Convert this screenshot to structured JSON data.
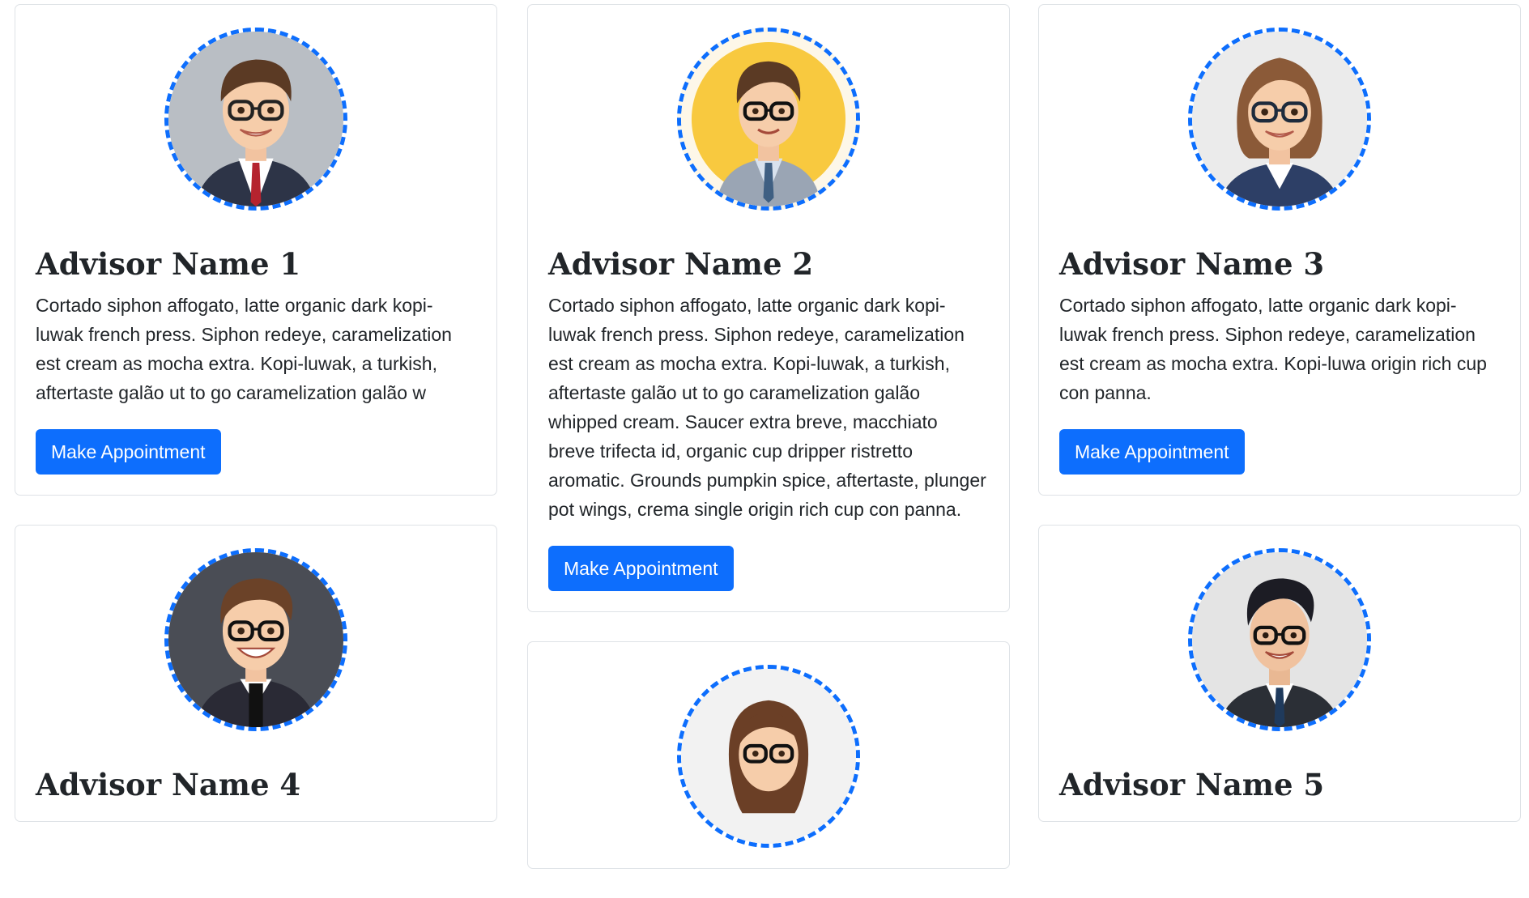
{
  "button_label": "Make Appointment",
  "advisors": [
    {
      "name": "Advisor Name 1",
      "bio": "Cortado siphon affogato, latte organic dark kopi-luwak french press. Siphon redeye, caramelization est cream as mocha extra. Kopi-luwak, a turkish, aftertaste galão ut to go caramelization galão w",
      "avatar_bg": "#b9bec4"
    },
    {
      "name": "Advisor Name 2",
      "bio": "Cortado siphon affogato, latte organic dark kopi-luwak french press. Siphon redeye, caramelization est cream as mocha extra. Kopi-luwak, a turkish, aftertaste galão ut to go caramelization galão whipped cream. Saucer extra breve, macchiato breve trifecta id, organic cup dripper ristretto aromatic. Grounds pumpkin spice, aftertaste, plunger pot wings, crema single origin rich cup con panna.",
      "avatar_bg": "#f8c93f"
    },
    {
      "name": "Advisor Name 3",
      "bio": "Cortado siphon affogato, latte organic dark kopi-luwak french press. Siphon redeye, caramelization est cream as mocha extra. Kopi-luwa origin rich cup con panna.",
      "avatar_bg": "#ebebeb"
    },
    {
      "name": "Advisor Name 4",
      "avatar_bg": "#4a4d55"
    },
    {
      "name": "Advisor Name 5",
      "avatar_bg": "#e4e4e4"
    },
    {
      "avatar_bg": "#f2f2f2"
    }
  ],
  "colors": {
    "primary": "#0d6efd",
    "border": "#dee2e6",
    "text": "#212529"
  }
}
